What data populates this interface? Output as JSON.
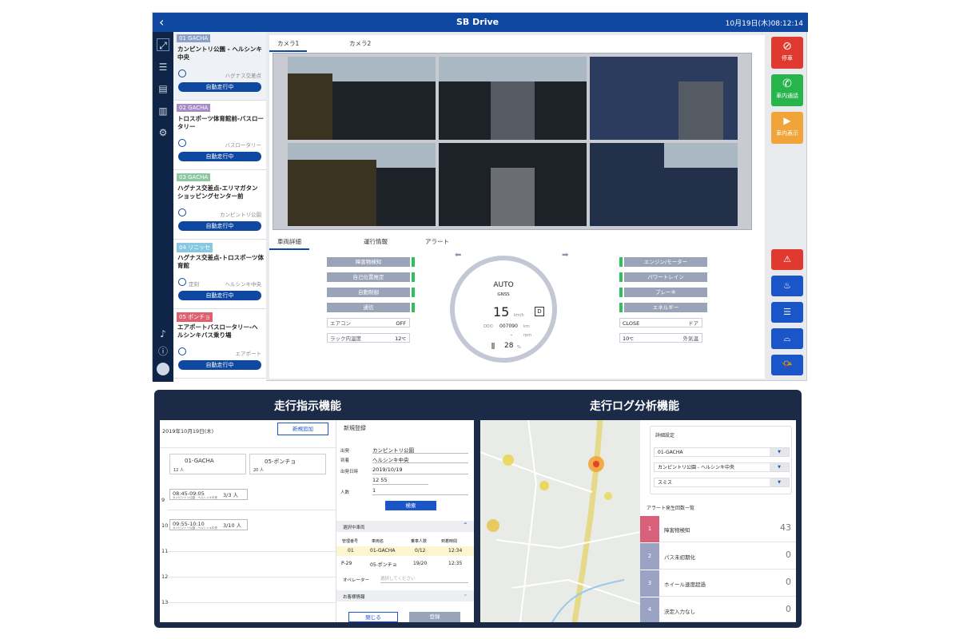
{
  "header": {
    "back": "‹",
    "brand": "SB Drive",
    "datetime": "10月19日(木)08:12:14"
  },
  "buses": [
    {
      "tag": "01  GACHA",
      "tag_color": "#8aa2c8",
      "name": "カンピントリ公園 - ヘルシンキ中央",
      "dest": "ハグナス交差点",
      "status": "自動走行中"
    },
    {
      "tag": "02  GACHA",
      "tag_color": "#a88cc8",
      "name": "トロスポーツ体育館前-バスロータリー",
      "dest": "バスロータリー",
      "status": "自動走行中"
    },
    {
      "tag": "03  GACHA",
      "tag_color": "#8bc8a0",
      "name": "ハグナス交差点-エリマガタンショッピングセンター前",
      "dest": "カンピントリ公園",
      "status": "自動走行中"
    },
    {
      "tag": "04  リニッセ",
      "tag_color": "#88c8e0",
      "name": "ハグナス交差点-トロスポーツ体育館",
      "dest": "ヘルシンキ中央",
      "dest_prefix": "定刻",
      "status": "自動走行中"
    },
    {
      "tag": "05  ポンチョ",
      "tag_color": "#e06070",
      "name": "エアポートバスロータリー-ヘルシンキバス乗り場",
      "dest": "エアポート",
      "status": "自動走行中"
    }
  ],
  "camera_tabs": [
    "カメラ1",
    "カメラ2"
  ],
  "detail_tabs": [
    "車両詳細",
    "運行情報",
    "アラート"
  ],
  "left_status": [
    "障害物検知",
    "自己位置推定",
    "自動制御",
    "通信"
  ],
  "aircon": {
    "label": "エアコン",
    "value": "OFF"
  },
  "rack_temp": {
    "label": "ラック内温度",
    "value": "12",
    "unit": "℃"
  },
  "right_status": [
    "エンジン/モーター",
    "パワートレイン",
    "ブレーキ",
    "エネルギー"
  ],
  "door": {
    "value": "CLOSE",
    "label": "ドア"
  },
  "outside_temp": {
    "value": "10",
    "unit": "℃",
    "label": "外気温"
  },
  "gauge": {
    "mode": "AUTO",
    "sub": "GNSS",
    "speed": "15",
    "speed_unit": "km/h",
    "gear": "D",
    "odo_label": "ODO",
    "odo": "007090",
    "odo_unit": "km",
    "rpm": "-",
    "rpm_unit": "rpm",
    "battery": "28",
    "battery_unit": "%"
  },
  "action_buttons": [
    {
      "label": "停車",
      "icon": "⊘",
      "color": "#e03a30"
    },
    {
      "label": "車内通話",
      "icon": "✆",
      "color": "#27b44a"
    },
    {
      "label": "車内表示",
      "icon": "▶",
      "color": "#f0a43a"
    }
  ],
  "bottom": {
    "left_title": "走行指示機能",
    "right_title": "走行ログ分析機能",
    "date": "2019年10月19日(木)",
    "new_add": "新規追加",
    "vehicles": [
      {
        "name": "01-GACHA",
        "cap": "12 人"
      },
      {
        "name": "05-ポンチョ",
        "cap": "20 人"
      }
    ],
    "trips": [
      {
        "time": "08:45-09:05",
        "count": "3/3 人",
        "route": "カンピントリ公園 - ヘルシンキ中央"
      },
      {
        "time": "09:55-10:10",
        "count": "3/10 人",
        "route": "カンピントリ公園 - ヘルシンキ中央"
      }
    ],
    "hours": [
      "9",
      "10",
      "11",
      "12",
      "13"
    ],
    "reg_title": "新規登録",
    "form": [
      {
        "label": "出発",
        "value": "カンピントリ公園"
      },
      {
        "label": "到着",
        "value": "ヘルシンキ中央"
      },
      {
        "label": "出発日時",
        "value": "2019/10/19"
      },
      {
        "label": "",
        "value": "12   55"
      },
      {
        "label": "人数",
        "value": "1"
      }
    ],
    "search": "検索",
    "selected_vehicles": "選択中車両",
    "veh_headers": [
      "管理番号",
      "車両名",
      "乗車人数",
      "到着時間"
    ],
    "veh_rows": [
      [
        "01",
        "01-GACHA",
        "0/12",
        "12:34"
      ],
      [
        "P-29",
        "05-ポンチョ",
        "19/20",
        "12:35"
      ]
    ],
    "operator_label": "オペレーター",
    "operator_placeholder": "選択してください",
    "customer_info": "お客様情報",
    "close": "閉じる",
    "register": "登録",
    "detail_settings": "詳細設定",
    "filters": [
      "01-GACHA",
      "カンピントリ公園 - ヘルシンキ中央",
      "スミス"
    ],
    "alert_list_title": "アラート発生回数一覧",
    "alerts": [
      {
        "n": "1",
        "label": "障害物検知",
        "count": "43",
        "color": "#d9607a"
      },
      {
        "n": "2",
        "label": "パス未初期化",
        "count": "0",
        "color": "#9aa3c4"
      },
      {
        "n": "3",
        "label": "ホイール速度超過",
        "count": "0",
        "color": "#9aa3c4"
      },
      {
        "n": "4",
        "label": "決定入力なし",
        "count": "0",
        "color": "#9aa3c4"
      }
    ]
  }
}
